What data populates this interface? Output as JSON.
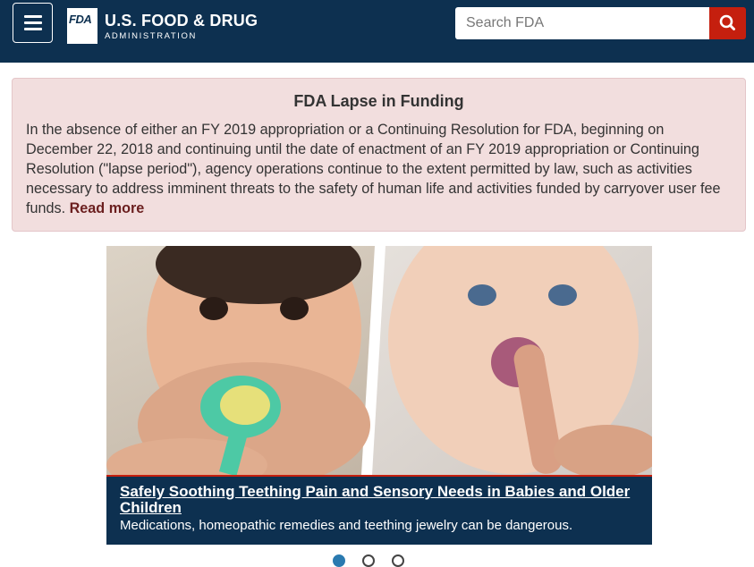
{
  "header": {
    "menu_icon": "hamburger-icon",
    "logo_badge": "FDA",
    "logo_title": "U.S. FOOD & DRUG",
    "logo_subtitle": "ADMINISTRATION",
    "search_placeholder": "Search FDA",
    "search_value": "",
    "search_icon": "search-icon"
  },
  "alert": {
    "title": "FDA Lapse in Funding",
    "body": "In the absence of either an FY 2019 appropriation or a Continuing Resolution for FDA, beginning on December 22, 2018 and continuing until the date of enactment of an FY 2019 appropriation or Continuing Resolution (\"lapse period\"), agency operations continue to the extent permitted by law, such as activities necessary to address imminent threats to the safety of human life and activities funded by carryover user fee funds.",
    "link_label": "Read more"
  },
  "carousel": {
    "caption_title": "Safely Soothing Teething Pain and Sensory Needs in Babies and Older Children",
    "caption_text": "Medications, homeopathic remedies and teething jewelry can be dangerous.",
    "active_slide": 1,
    "slide_count": 3
  },
  "colors": {
    "header_bg": "#0d3050",
    "search_button": "#c51f0e",
    "alert_bg": "#f2dede",
    "caption_accent": "#c51f0e"
  }
}
